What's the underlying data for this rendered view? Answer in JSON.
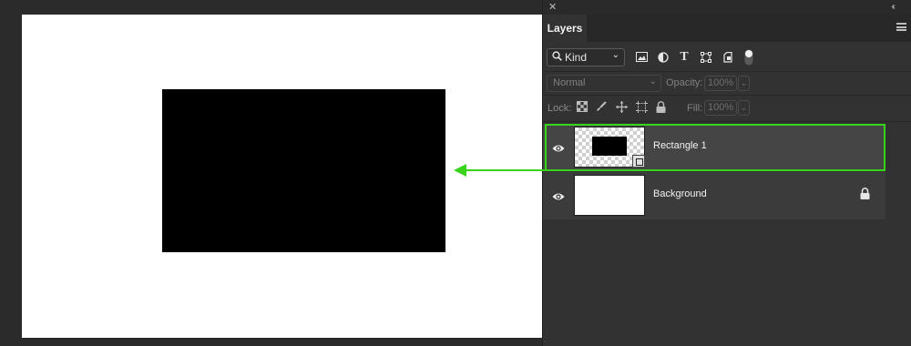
{
  "colors": {
    "highlight": "#39d31b",
    "arrow": "#39d31b",
    "canvas": "#ffffff",
    "shape": "#000000"
  },
  "panel": {
    "close_icon": "✕",
    "collapse_icon": "‹‹",
    "tab_label": "Layers",
    "menu_icon": "hamburger-icon"
  },
  "filter": {
    "kind_label": "Kind",
    "icons": [
      "image-filter-icon",
      "adjustment-filter-icon",
      "type-filter-icon",
      "shape-filter-icon",
      "smart-object-filter-icon",
      "filter-toggle-icon"
    ]
  },
  "blend": {
    "mode": "Normal",
    "opacity_label": "Opacity:",
    "opacity_value": "100%"
  },
  "lock": {
    "label": "Lock:",
    "icons": [
      "lock-transparent-pixels-icon",
      "lock-image-pixels-icon",
      "lock-position-icon",
      "lock-artboard-icon",
      "lock-all-icon"
    ],
    "fill_label": "Fill:",
    "fill_value": "100%"
  },
  "layers": [
    {
      "name": "Rectangle 1",
      "visible": true,
      "selected": true,
      "type": "shape"
    },
    {
      "name": "Background",
      "visible": true,
      "selected": false,
      "locked": true
    }
  ]
}
